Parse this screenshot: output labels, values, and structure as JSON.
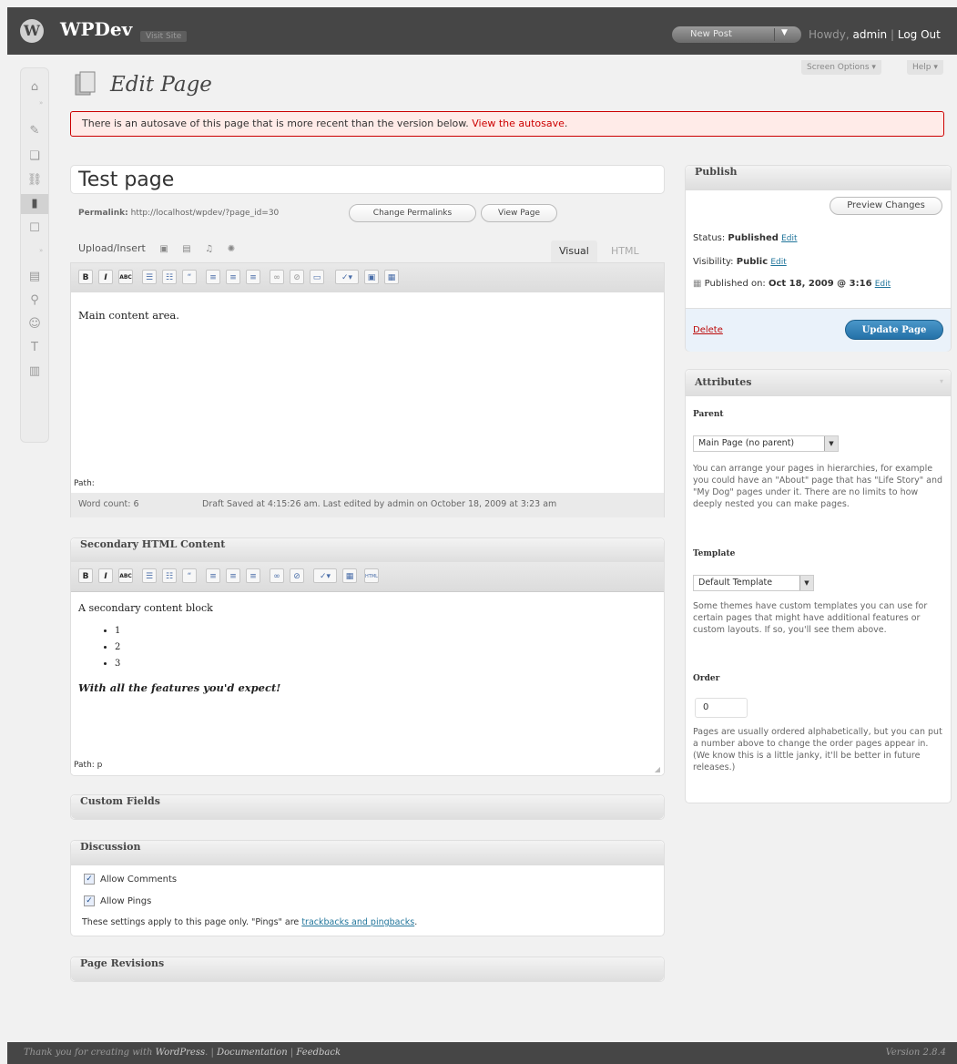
{
  "header": {
    "site_title": "WPDev",
    "visit_site": "Visit Site",
    "new_post": "New Post",
    "howdy_prefix": "Howdy,",
    "user": "admin",
    "separator": "|",
    "logout": "Log Out"
  },
  "left_menu": [
    {
      "icon": "dashboard-icon",
      "glyph": "⌂"
    },
    {
      "icon": "posts-icon",
      "glyph": "✎"
    },
    {
      "icon": "media-icon",
      "glyph": "❏"
    },
    {
      "icon": "links-icon",
      "glyph": "⛓"
    },
    {
      "icon": "pages-icon",
      "glyph": "▮",
      "current": true
    },
    {
      "icon": "comments-icon",
      "glyph": "☐"
    },
    {
      "icon": "appearance-icon",
      "glyph": "▤"
    },
    {
      "icon": "plugins-icon",
      "glyph": "⚲"
    },
    {
      "icon": "users-icon",
      "glyph": "☺"
    },
    {
      "icon": "tools-icon",
      "glyph": "T"
    },
    {
      "icon": "settings-icon",
      "glyph": "▥"
    }
  ],
  "screen_options": "Screen Options",
  "help": "Help",
  "page_title": "Edit Page",
  "notice": {
    "text": "There is an autosave of this page that is more recent than the version below.",
    "link": "View the autosave",
    "end": "."
  },
  "post_title": "Test page",
  "permalink": {
    "label": "Permalink:",
    "url": "http://localhost/wpdev/?page_id=30",
    "change_button": "Change Permalinks",
    "view_button": "View Page"
  },
  "upload_insert": "Upload/Insert",
  "editor_tabs": {
    "visual": "Visual",
    "html": "HTML"
  },
  "main_editor": {
    "content": "Main content area.",
    "path_label": "Path:",
    "word_count": "Word count: 6",
    "draft_status": "Draft Saved at 4:15:26 am. Last edited by admin on October 18, 2009 at 3:23 am"
  },
  "secondary": {
    "title": "Secondary HTML Content",
    "intro": "A secondary content block",
    "items": [
      "1",
      "2",
      "3"
    ],
    "closing": "With all the features you'd expect!",
    "path": "Path: p"
  },
  "custom_fields": "Custom Fields",
  "discussion": {
    "title": "Discussion",
    "allow_comments": "Allow Comments",
    "allow_pings": "Allow Pings",
    "note": "These settings apply to this page only. \"Pings\" are",
    "note_link": "trackbacks and pingbacks",
    "note_end": "."
  },
  "page_revisions": "Page Revisions",
  "publish": {
    "title": "Publish",
    "preview_button": "Preview Changes",
    "status_label": "Status:",
    "status_value": "Published",
    "visibility_label": "Visibility:",
    "visibility_value": "Public",
    "published_label": "Published on:",
    "published_value": "Oct 18, 2009 @ 3:16",
    "edit": "Edit",
    "delete": "Delete",
    "update_button": "Update Page"
  },
  "attributes": {
    "title": "Attributes",
    "parent_label": "Parent",
    "parent_value": "Main Page (no parent)",
    "parent_help": "You can arrange your pages in hierarchies, for example you could have an \"About\" page that has \"Life Story\" and \"My Dog\" pages under it. There are no limits to how deeply nested you can make pages.",
    "template_label": "Template",
    "template_value": "Default Template",
    "template_help": "Some themes have custom templates you can use for certain pages that might have additional features or custom layouts. If so, you'll see them above.",
    "order_label": "Order",
    "order_value": "0",
    "order_help": "Pages are usually ordered alphabetically, but you can put a number above to change the order pages appear in. (We know this is a little janky, it'll be better in future releases.)"
  },
  "footer": {
    "thanks_prefix": "Thank you for creating with",
    "wordpress": "WordPress",
    "dot": ".",
    "sep": "|",
    "documentation": "Documentation",
    "feedback": "Feedback",
    "version": "Version 2.8.4"
  },
  "colors": {
    "header_bg": "#464646",
    "accent_blue": "#21759b",
    "notice_border": "#cc0000",
    "notice_bg": "#ffebe8",
    "update_button": "#2e7db4"
  }
}
